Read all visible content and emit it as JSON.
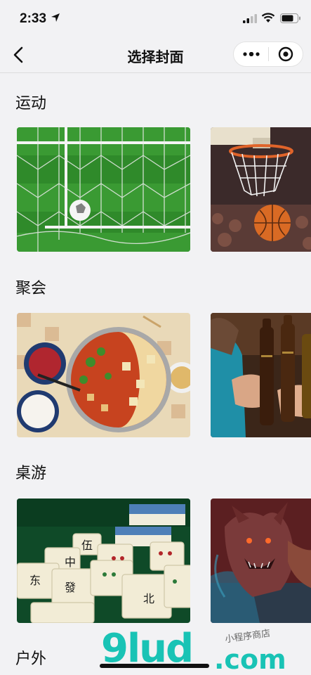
{
  "status": {
    "time": "2:33"
  },
  "nav": {
    "title": "选择封面"
  },
  "sections": [
    {
      "title": "运动",
      "images": [
        "soccer-goal-net",
        "basketball-hoop"
      ]
    },
    {
      "title": "聚会",
      "images": [
        "hotpot-dinner",
        "beer-toast"
      ]
    },
    {
      "title": "桌游",
      "images": [
        "mahjong-tiles",
        "werewolf-card"
      ]
    },
    {
      "title": "户外",
      "images": []
    }
  ],
  "watermark": {
    "brand": "9lud",
    "suffix": ".com",
    "sub": "小程序商店"
  },
  "colors": {
    "accent": "#19c3b5",
    "background": "#f2f2f4"
  }
}
